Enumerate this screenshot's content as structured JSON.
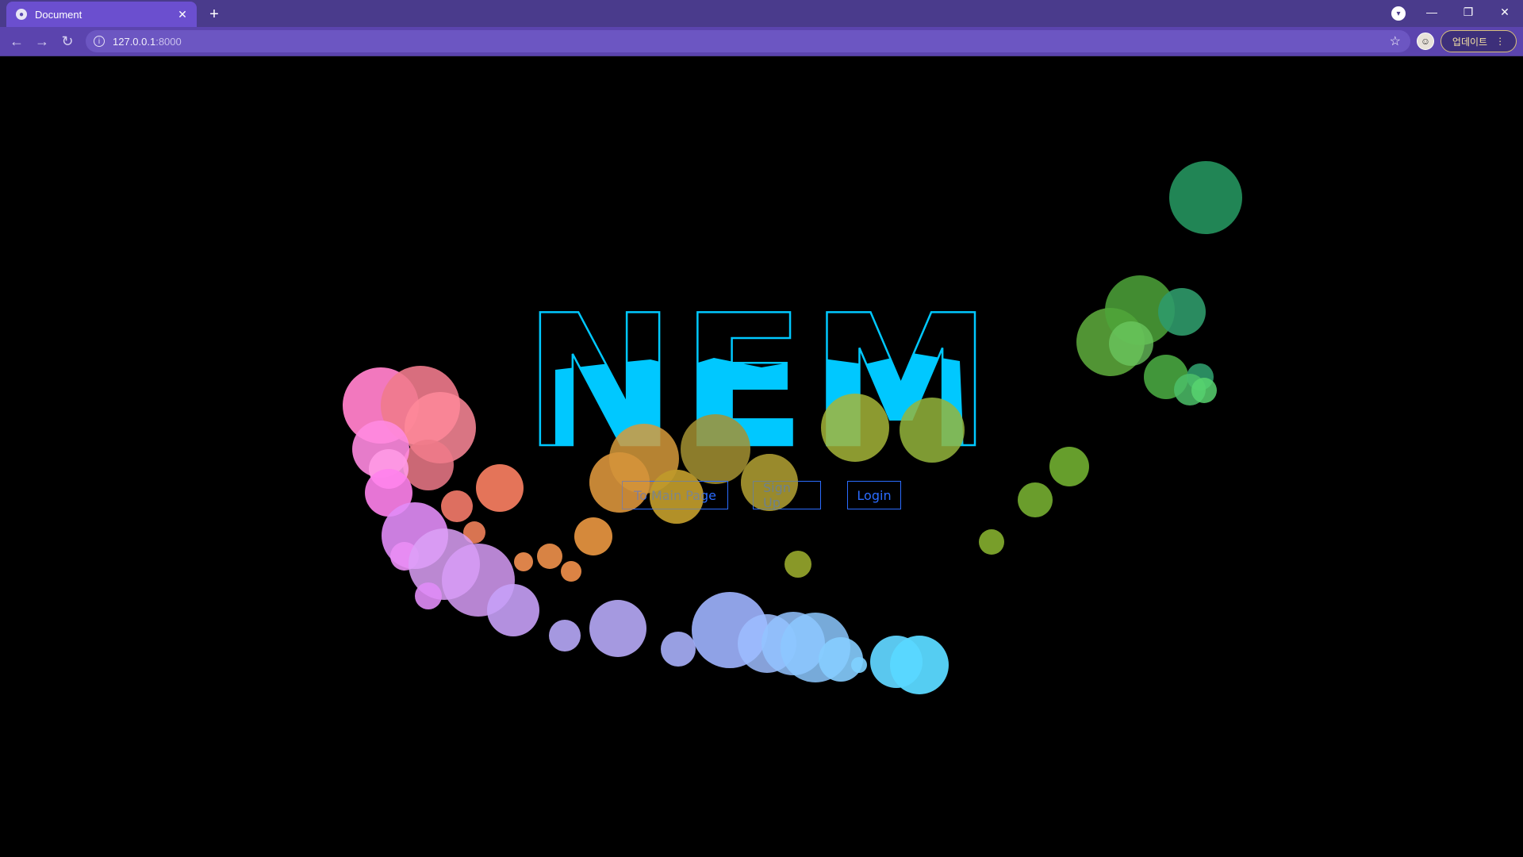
{
  "browser": {
    "tab_title": "Document",
    "url_host": "127.0.0.1",
    "url_port": ":8000",
    "update_label": "업데이트"
  },
  "page": {
    "logo_text": "NEM",
    "buttons": {
      "main": "To Main Page",
      "signup": "Sign Up",
      "login": "Login"
    }
  },
  "colors": {
    "accent": "#2b6cff",
    "logo": "#00c8ff",
    "chrome": "#4a3b8c"
  }
}
